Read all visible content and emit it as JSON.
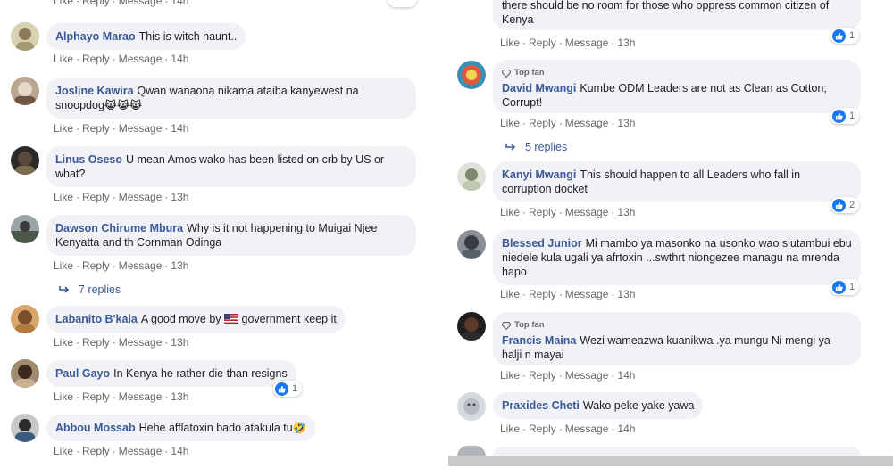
{
  "actions": {
    "like": "Like",
    "reply": "Reply",
    "message": "Message",
    "sep": "·"
  },
  "left": [
    {
      "author": "Alphayo Marao",
      "text": "This is witch haunt..",
      "time": "14h"
    },
    {
      "author": "Josline Kawira",
      "text": "Qwan wanaona nikama ataiba kanyewest na snoopdog",
      "emoji": "😹😹😹",
      "time": "14h"
    },
    {
      "author": "Linus Oseso",
      "text": "U mean Amos wako has been listed on crb by US or what?",
      "time": "13h"
    },
    {
      "author": "Dawson Chirume Mbura",
      "text": "Why is it not happening to Muigai Njee Kenyatta and th Cornman Odinga",
      "time": "13h",
      "replies": "7 replies"
    },
    {
      "author": "Labanito B'kala",
      "text_before": "A good move by",
      "text_after": "government keep it",
      "time": "13h"
    },
    {
      "author": "Paul Gayo",
      "text": "In Kenya he rather die than resigns",
      "time": "13h",
      "reactions": "1"
    },
    {
      "author": "Abbou Mossab",
      "text": "Hehe afflatoxin bado atakula tu",
      "emoji": "🤣",
      "time": "14h"
    }
  ],
  "right": [
    {
      "text": "there should be no room for those who oppress common citizen of Kenya",
      "time": "13h",
      "reactions": "1"
    },
    {
      "badge": "Top fan",
      "author": "David Mwangi",
      "text": "Kumbe ODM Leaders are not as Clean as Cotton; Corrupt!",
      "time": "13h",
      "reactions": "1",
      "replies": "5 replies"
    },
    {
      "author": "Kanyi Mwangi",
      "text": "This should happen to all Leaders who fall in corruption docket",
      "time": "13h",
      "reactions": "2"
    },
    {
      "author": "Blessed Junior",
      "text": "Mi mambo ya masonko na usonko wao siutambui ebu niedele kula ugali ya afrtoxin ...swthrt niongezee managu na mrenda hapo",
      "time": "13h",
      "reactions": "1"
    },
    {
      "badge": "Top fan",
      "author": "Francis Maina",
      "text": "Wezi wameazwa kuanikwa .ya mungu Ni mengi ya halji n mayai",
      "time": "14h"
    },
    {
      "author": "Praxides Cheti",
      "text": "Wako peke yake yawa",
      "time": "14h"
    }
  ],
  "top_partial": {
    "time": "14h"
  },
  "colors": {
    "link": "#3b5998",
    "bubble": "#f0f2f5",
    "like_blue": "#1877f2",
    "meta": "#65676b"
  },
  "icons": [
    "like-icon",
    "reply-arrow-icon",
    "top-fan-badge-icon",
    "kenya-us-flag-icon"
  ]
}
